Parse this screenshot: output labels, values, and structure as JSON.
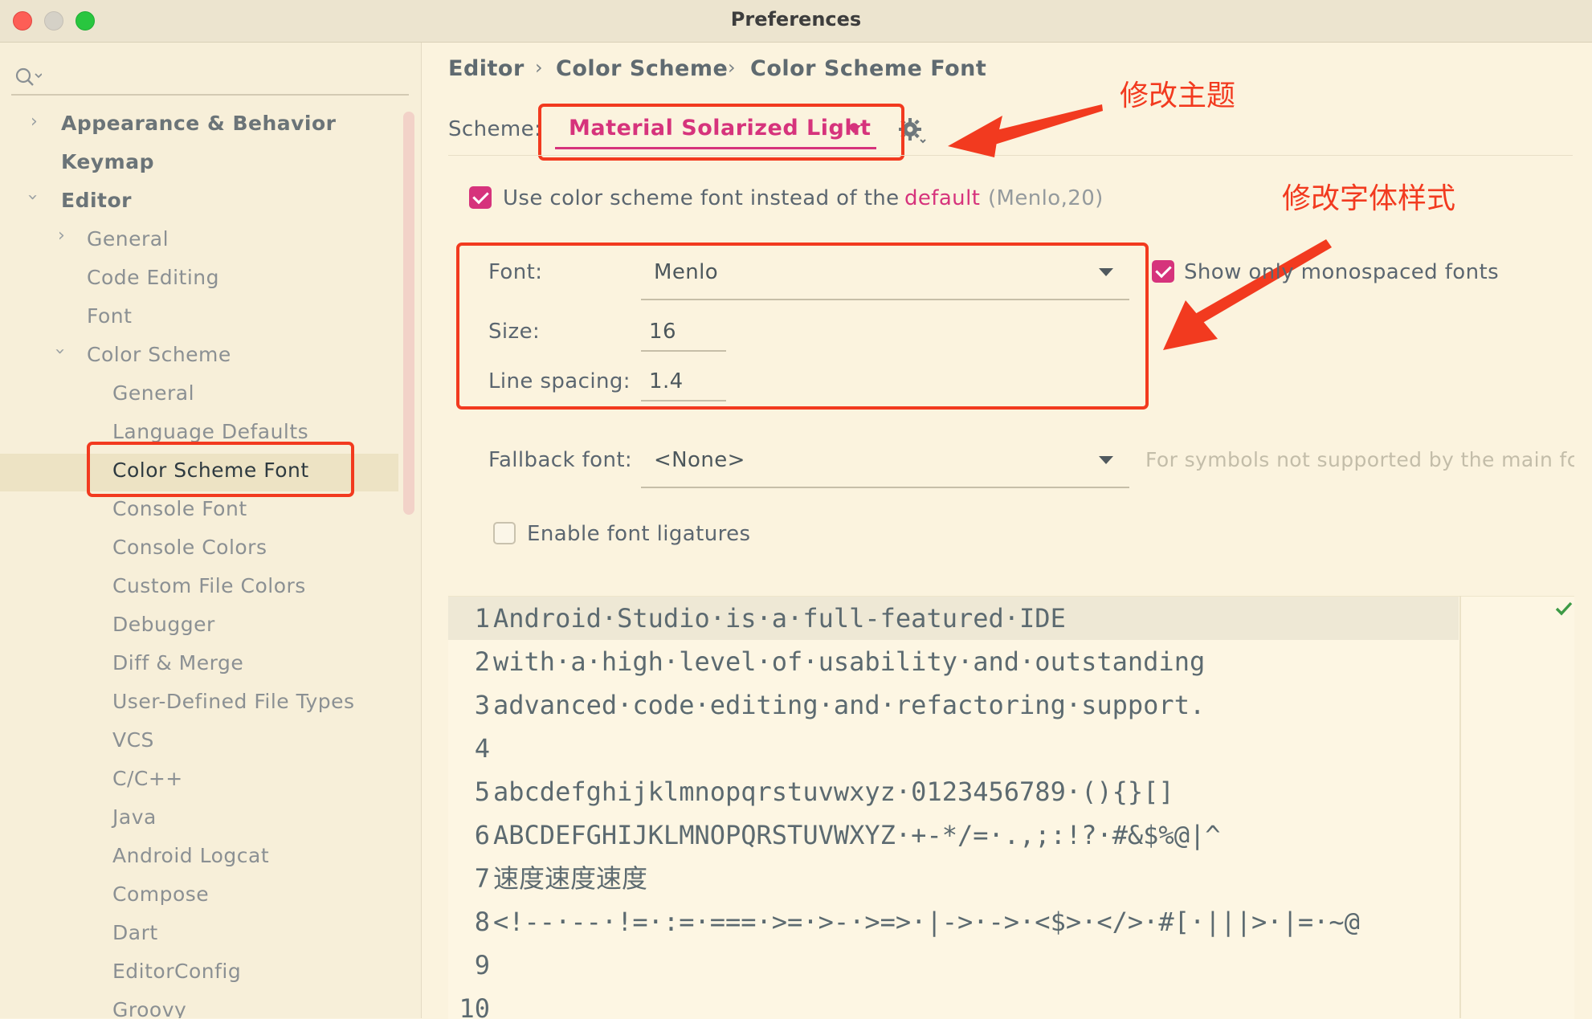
{
  "window": {
    "title": "Preferences"
  },
  "sidebar": {
    "search_placeholder": "",
    "items": [
      {
        "label": "Appearance & Behavior"
      },
      {
        "label": "Keymap"
      },
      {
        "label": "Editor"
      },
      {
        "label": "General"
      },
      {
        "label": "Code Editing"
      },
      {
        "label": "Font"
      },
      {
        "label": "Color Scheme"
      },
      {
        "label": "General"
      },
      {
        "label": "Language Defaults"
      },
      {
        "label": "Color Scheme Font"
      },
      {
        "label": "Console Font"
      },
      {
        "label": "Console Colors"
      },
      {
        "label": "Custom File Colors"
      },
      {
        "label": "Debugger"
      },
      {
        "label": "Diff & Merge"
      },
      {
        "label": "User-Defined File Types"
      },
      {
        "label": "VCS"
      },
      {
        "label": "C/C++"
      },
      {
        "label": "Java"
      },
      {
        "label": "Android Logcat"
      },
      {
        "label": "Compose"
      },
      {
        "label": "Dart"
      },
      {
        "label": "EditorConfig"
      },
      {
        "label": "Groovy"
      }
    ]
  },
  "breadcrumb": [
    "Editor",
    "Color Scheme",
    "Color Scheme Font"
  ],
  "scheme": {
    "label": "Scheme:",
    "value": "Material Solarized Light"
  },
  "use_scheme_font": {
    "checked": true,
    "text": "Use color scheme font instead of the",
    "link": "default",
    "suffix": "(Menlo,20)"
  },
  "font": {
    "label": "Font:",
    "value": "Menlo"
  },
  "size": {
    "label": "Size:",
    "value": "16"
  },
  "line_spacing": {
    "label": "Line spacing:",
    "value": "1.4"
  },
  "show_mono": {
    "checked": true,
    "label": "Show only monospaced fonts"
  },
  "fallback": {
    "label": "Fallback font:",
    "value": "<None>",
    "hint": "For symbols not supported by the main fc"
  },
  "ligatures": {
    "checked": false,
    "label": "Enable font ligatures"
  },
  "annotations": {
    "theme": "修改主题",
    "font_style": "修改字体样式"
  },
  "preview_lines": [
    {
      "num": "1",
      "text": "Android·Studio·is·a·full-featured·IDE"
    },
    {
      "num": "2",
      "text": "with·a·high·level·of·usability·and·outstanding"
    },
    {
      "num": "3",
      "text": "advanced·code·editing·and·refactoring·support."
    },
    {
      "num": "4",
      "text": ""
    },
    {
      "num": "5",
      "text": "abcdefghijklmnopqrstuvwxyz·0123456789·(){}[]"
    },
    {
      "num": "6",
      "text": "ABCDEFGHIJKLMNOPQRSTUVWXYZ·+-*/=·.,;:!?·#&$%@|^"
    },
    {
      "num": "7",
      "text": "速度速度速度"
    },
    {
      "num": "8",
      "text": "<!--·--·!=·:=·===·>=·>-·>=>·|->·->·<$>·</>·#[·|||>·|=·~@"
    },
    {
      "num": "9",
      "text": ""
    },
    {
      "num": "10",
      "text": ""
    }
  ],
  "colors": {
    "accent": "#d6337c",
    "annotation": "#f23a1f",
    "background": "#fbf3de",
    "selection": "#ede3c4"
  }
}
